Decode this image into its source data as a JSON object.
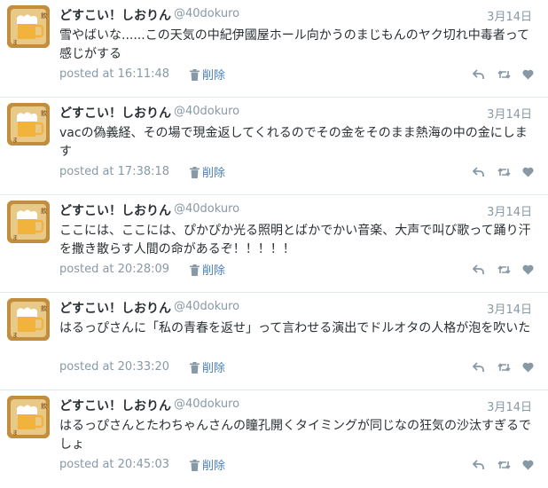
{
  "colors": {
    "text": "#292f33",
    "muted": "#8899a6",
    "link": "#4a7fb5",
    "divider": "#e1e8ed",
    "avatar_bg": "#c28d3c"
  },
  "icons": {
    "avatar": "avatar-beer-illustration",
    "delete": "trash-icon",
    "reply": "reply-icon",
    "retweet": "retweet-icon",
    "favorite": "heart-icon"
  },
  "tweets": [
    {
      "name": "どすこい！しおりん",
      "handle": "@40dokuro",
      "date": "3月14日",
      "text": "雪やばいな......この天気の中紀伊國屋ホール向かうのまじもんのヤク切れ中毒者って感じがする",
      "posted": "posted at 16:11:48",
      "delete_label": "削除"
    },
    {
      "name": "どすこい！しおりん",
      "handle": "@40dokuro",
      "date": "3月14日",
      "text": "vacの偽義経、その場で現金返してくれるのでその金をそのまま熱海の中の金にします",
      "posted": "posted at 17:38:18",
      "delete_label": "削除"
    },
    {
      "name": "どすこい！しおりん",
      "handle": "@40dokuro",
      "date": "3月14日",
      "text": "ここには、ここには、ぴかぴか光る照明とばかでかい音楽、大声で叫び歌って踊り汗を撒き散らす人間の命があるぞ！！！！！",
      "posted": "posted at 20:28:09",
      "delete_label": "削除"
    },
    {
      "name": "どすこい！しおりん",
      "handle": "@40dokuro",
      "date": "3月14日",
      "text": "はるっぴさんに「私の青春を返せ」って言わせる演出でドルオタの人格が泡を吹いた",
      "posted": "posted at 20:33:20",
      "delete_label": "削除"
    },
    {
      "name": "どすこい！しおりん",
      "handle": "@40dokuro",
      "date": "3月14日",
      "text": "はるっぴさんとたわちゃんさんの瞳孔開くタイミングが同じなの狂気の沙汰すぎるでしょ",
      "posted": "posted at 20:45:03",
      "delete_label": "削除"
    }
  ]
}
